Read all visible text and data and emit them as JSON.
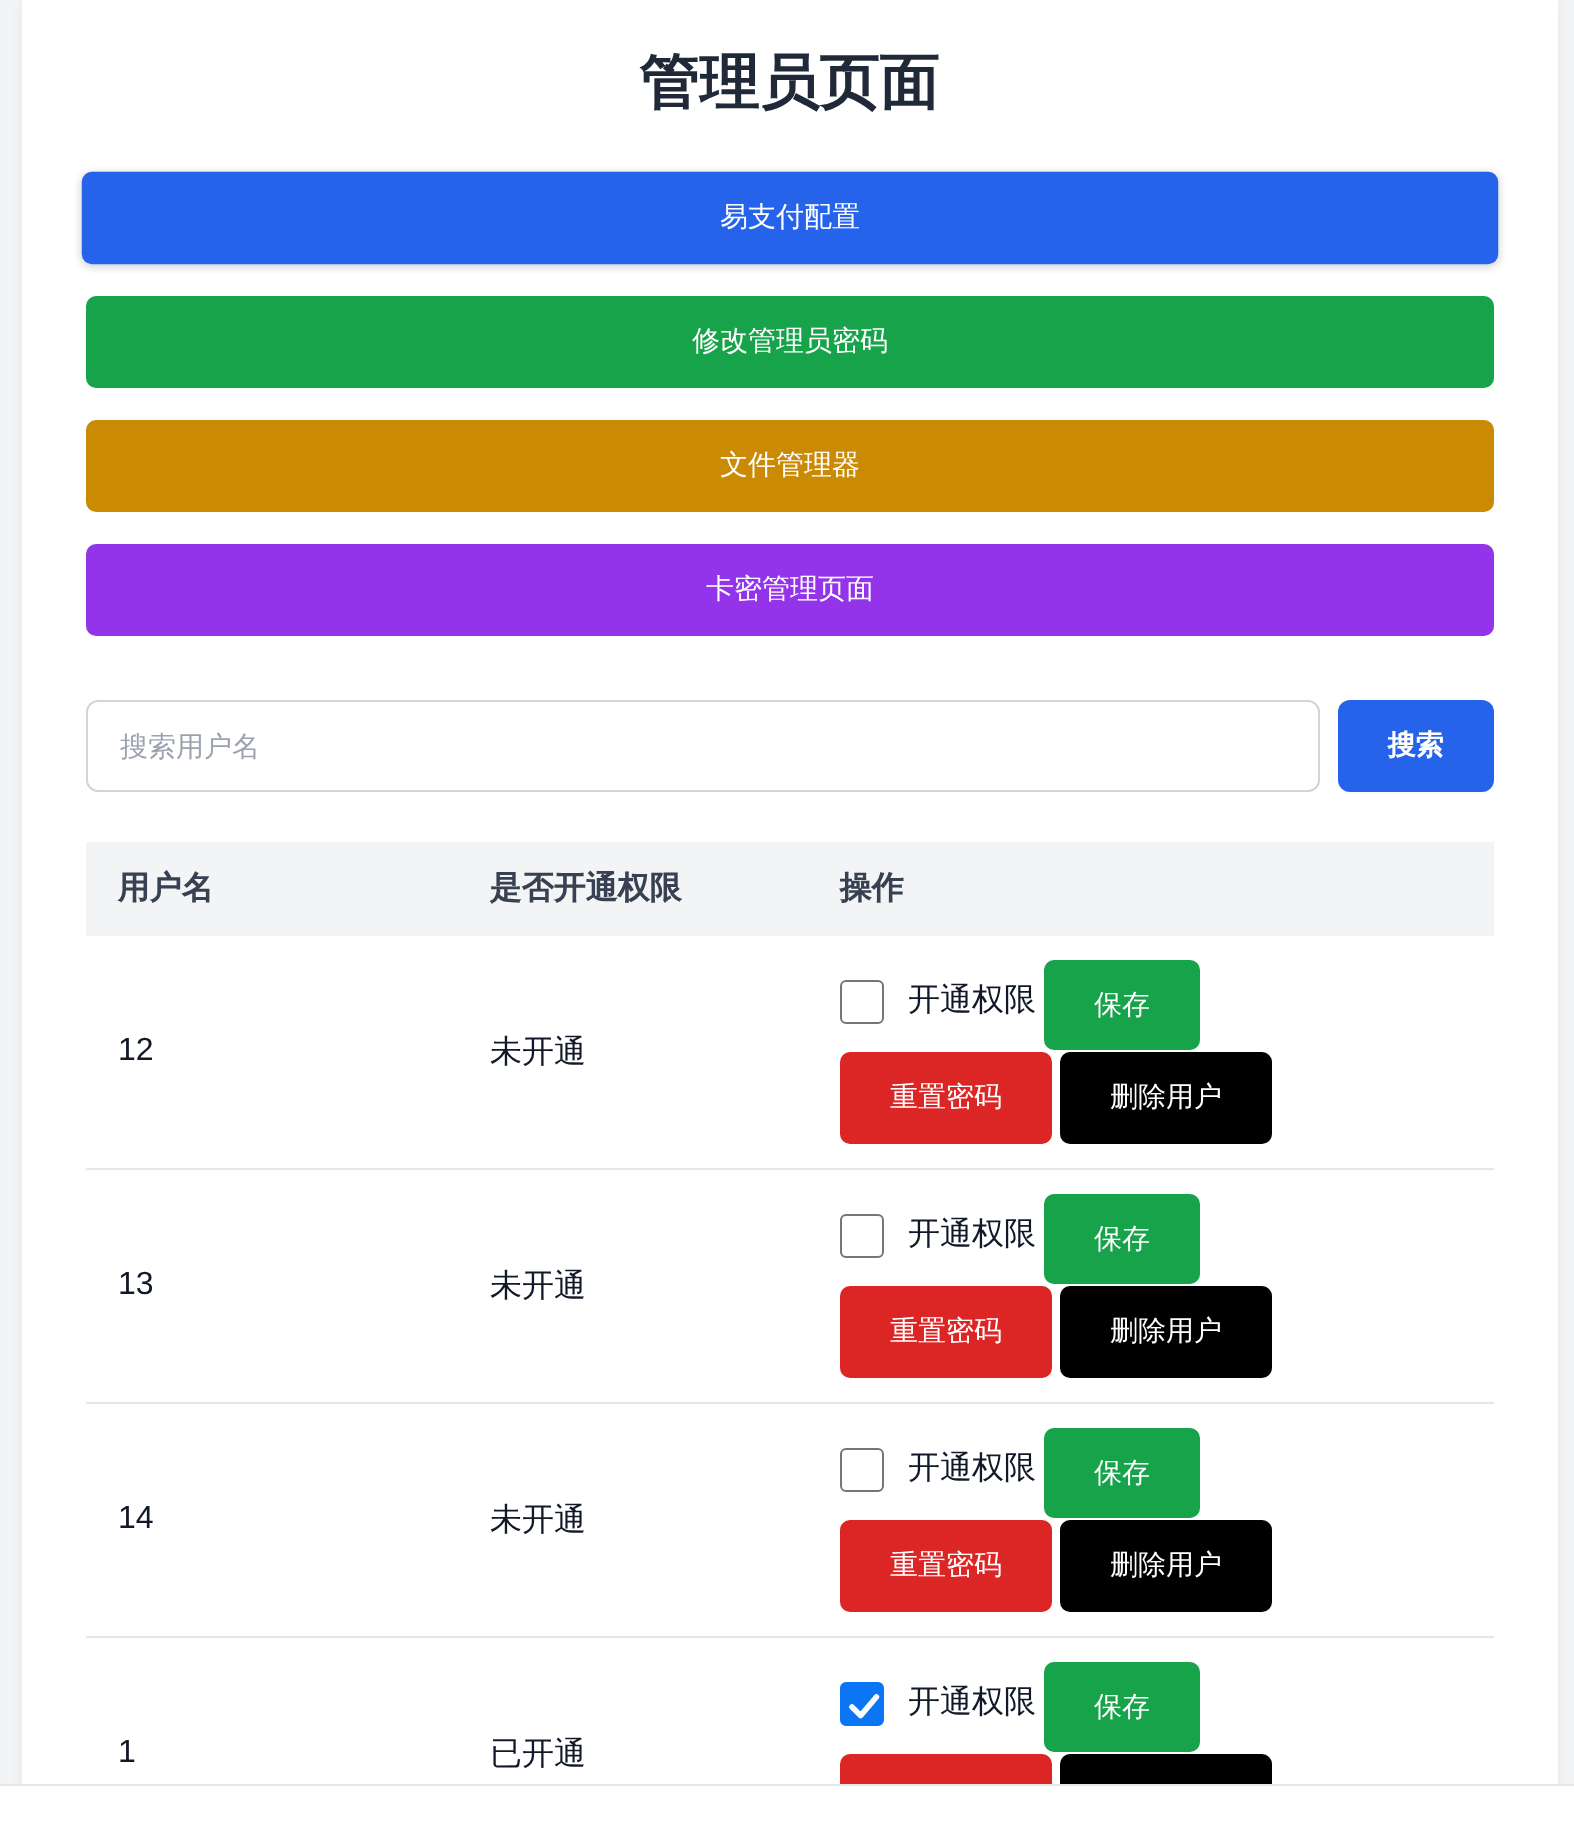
{
  "page": {
    "title": "管理员页面"
  },
  "nav_buttons": [
    {
      "label": "易支付配置",
      "color": "#2563eb",
      "hovered": true
    },
    {
      "label": "修改管理员密码",
      "color": "#16a34a",
      "hovered": false
    },
    {
      "label": "文件管理器",
      "color": "#ca8a04",
      "hovered": false
    },
    {
      "label": "卡密管理页面",
      "color": "#9333ea",
      "hovered": false
    }
  ],
  "search": {
    "placeholder": "搜索用户名",
    "button": "搜索"
  },
  "table": {
    "columns": [
      "用户名",
      "是否开通权限",
      "操作"
    ],
    "rows": [
      {
        "username": "12",
        "status": "未开通",
        "checkbox_label": "开通权限",
        "checked": false,
        "actions": [
          {
            "kind": "save",
            "label": "保存"
          },
          {
            "kind": "reset",
            "label": "重置密码"
          },
          {
            "kind": "delete",
            "label": "删除用户"
          }
        ]
      },
      {
        "username": "13",
        "status": "未开通",
        "checkbox_label": "开通权限",
        "checked": false,
        "actions": [
          {
            "kind": "save",
            "label": "保存"
          },
          {
            "kind": "reset",
            "label": "重置密码"
          },
          {
            "kind": "delete",
            "label": "删除用户"
          }
        ]
      },
      {
        "username": "14",
        "status": "未开通",
        "checkbox_label": "开通权限",
        "checked": false,
        "actions": [
          {
            "kind": "save",
            "label": "保存"
          },
          {
            "kind": "reset",
            "label": "重置密码"
          },
          {
            "kind": "delete",
            "label": "删除用户"
          }
        ]
      },
      {
        "username": "1",
        "status": "已开通",
        "checkbox_label": "开通权限",
        "checked": true,
        "actions": [
          {
            "kind": "save",
            "label": "保存"
          },
          {
            "kind": "reset"
          },
          {
            "kind": "delete"
          }
        ]
      }
    ]
  }
}
